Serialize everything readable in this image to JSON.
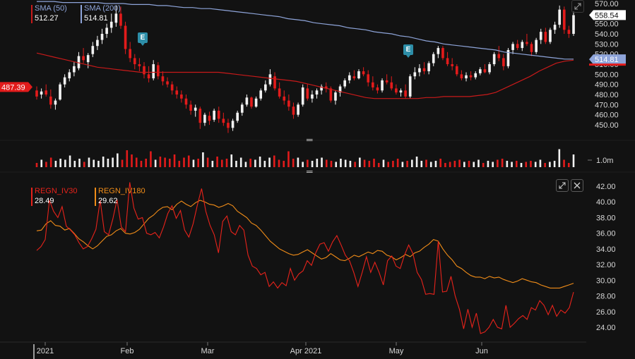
{
  "ticker_legends": {
    "sma50": {
      "label": "SMA (50)",
      "value": "512.27",
      "color": "#c81a1a"
    },
    "sma200": {
      "label": "SMA (200)",
      "value": "514.81",
      "color": "#8ea4d9"
    },
    "iv30": {
      "label": "REGN_IV30",
      "value": "28.49",
      "color": "#e8231b"
    },
    "iv180": {
      "label": "REGN_IV180",
      "value": "29.62",
      "color": "#f08c18"
    }
  },
  "price_flags": {
    "last_price": "558.54",
    "sma200_flag": "514.81",
    "left_flag": "487.39"
  },
  "earnings_markers": [
    "E",
    "E"
  ],
  "volume_label": "1.0m",
  "chart_data": [
    {
      "type": "candlestick",
      "name": "price",
      "y_ticks": [
        450,
        460,
        470,
        480,
        490,
        500,
        510,
        520,
        530,
        540,
        550,
        560,
        570
      ],
      "ylim": [
        441,
        572
      ],
      "x_ticks": [
        "2021",
        "Feb",
        "Mar",
        "Apr 2021",
        "May",
        "Jun"
      ],
      "candles": [
        [
          484,
          488,
          475,
          478
        ],
        [
          480,
          486,
          476,
          483
        ],
        [
          484,
          490,
          478,
          480
        ],
        [
          478,
          485,
          466,
          470
        ],
        [
          470,
          476,
          465,
          474
        ],
        [
          475,
          492,
          474,
          490
        ],
        [
          490,
          500,
          487,
          497
        ],
        [
          496,
          505,
          493,
          502
        ],
        [
          502,
          512,
          498,
          508
        ],
        [
          506,
          522,
          504,
          518
        ],
        [
          518,
          526,
          511,
          514
        ],
        [
          512,
          521,
          506,
          519
        ],
        [
          520,
          532,
          517,
          528
        ],
        [
          528,
          538,
          524,
          534
        ],
        [
          534,
          545,
          530,
          540
        ],
        [
          540,
          550,
          536,
          546
        ],
        [
          546,
          560,
          541,
          552
        ],
        [
          551,
          568,
          547,
          560
        ],
        [
          560,
          567,
          545,
          548
        ],
        [
          548,
          552,
          520,
          525
        ],
        [
          525,
          532,
          512,
          516
        ],
        [
          516,
          520,
          505,
          510
        ],
        [
          510,
          516,
          503,
          508
        ],
        [
          508,
          512,
          496,
          500
        ],
        [
          500,
          508,
          492,
          496
        ],
        [
          496,
          514,
          494,
          510
        ],
        [
          509,
          512,
          495,
          498
        ],
        [
          498,
          503,
          489,
          493
        ],
        [
          493,
          497,
          487,
          490
        ],
        [
          490,
          493,
          480,
          484
        ],
        [
          484,
          488,
          476,
          480
        ],
        [
          480,
          484,
          472,
          476
        ],
        [
          476,
          480,
          466,
          470
        ],
        [
          470,
          474,
          460,
          464
        ],
        [
          464,
          470,
          458,
          467
        ],
        [
          466,
          468,
          446,
          452
        ],
        [
          452,
          462,
          449,
          460
        ],
        [
          459,
          463,
          450,
          454
        ],
        [
          455,
          466,
          453,
          464
        ],
        [
          464,
          468,
          452,
          456
        ],
        [
          456,
          462,
          449,
          452
        ],
        [
          452,
          456,
          442,
          447
        ],
        [
          447,
          456,
          444,
          454
        ],
        [
          454,
          464,
          452,
          462
        ],
        [
          462,
          472,
          459,
          470
        ],
        [
          470,
          480,
          468,
          477
        ],
        [
          477,
          478,
          466,
          468
        ],
        [
          468,
          478,
          467,
          476
        ],
        [
          476,
          486,
          474,
          484
        ],
        [
          484,
          494,
          482,
          490
        ],
        [
          490,
          505,
          488,
          500
        ],
        [
          498,
          502,
          484,
          486
        ],
        [
          486,
          492,
          476,
          478
        ],
        [
          478,
          484,
          470,
          474
        ],
        [
          474,
          480,
          464,
          468
        ],
        [
          468,
          472,
          456,
          460
        ],
        [
          460,
          472,
          458,
          470
        ],
        [
          470,
          490,
          468,
          487
        ],
        [
          486,
          490,
          474,
          476
        ],
        [
          476,
          484,
          472,
          480
        ],
        [
          480,
          486,
          476,
          484
        ],
        [
          484,
          490,
          480,
          488
        ],
        [
          488,
          492,
          482,
          486
        ],
        [
          486,
          488,
          472,
          474
        ],
        [
          474,
          484,
          470,
          482
        ],
        [
          482,
          490,
          478,
          488
        ],
        [
          488,
          496,
          486,
          494
        ],
        [
          494,
          502,
          491,
          499
        ],
        [
          498,
          504,
          494,
          496
        ],
        [
          496,
          505,
          495,
          503
        ],
        [
          503,
          507,
          498,
          500
        ],
        [
          500,
          504,
          488,
          492
        ],
        [
          492,
          498,
          484,
          487
        ],
        [
          487,
          490,
          481,
          484
        ],
        [
          484,
          496,
          482,
          494
        ],
        [
          494,
          500,
          490,
          492
        ],
        [
          492,
          498,
          484,
          486
        ],
        [
          486,
          490,
          480,
          482
        ],
        [
          482,
          486,
          478,
          484
        ],
        [
          484,
          490,
          476,
          478
        ],
        [
          478,
          500,
          476,
          498
        ],
        [
          498,
          507,
          495,
          502
        ],
        [
          502,
          510,
          498,
          506
        ],
        [
          506,
          512,
          500,
          503
        ],
        [
          503,
          513,
          500,
          511
        ],
        [
          511,
          522,
          508,
          520
        ],
        [
          520,
          528,
          516,
          526
        ],
        [
          526,
          528,
          514,
          516
        ],
        [
          516,
          522,
          508,
          510
        ],
        [
          510,
          516,
          504,
          508
        ],
        [
          508,
          510,
          498,
          500
        ],
        [
          500,
          504,
          494,
          496
        ],
        [
          496,
          502,
          493,
          499
        ],
        [
          499,
          503,
          494,
          497
        ],
        [
          497,
          503,
          495,
          501
        ],
        [
          501,
          507,
          499,
          505
        ],
        [
          505,
          510,
          501,
          502
        ],
        [
          502,
          512,
          500,
          510
        ],
        [
          510,
          522,
          508,
          520
        ],
        [
          520,
          528,
          513,
          516
        ],
        [
          516,
          520,
          504,
          508
        ],
        [
          508,
          526,
          506,
          524
        ],
        [
          524,
          532,
          520,
          530
        ],
        [
          530,
          534,
          524,
          526
        ],
        [
          526,
          534,
          523,
          532
        ],
        [
          532,
          540,
          528,
          530
        ],
        [
          530,
          532,
          518,
          522
        ],
        [
          522,
          536,
          520,
          534
        ],
        [
          534,
          545,
          530,
          542
        ],
        [
          542,
          546,
          530,
          532
        ],
        [
          532,
          546,
          530,
          544
        ],
        [
          544,
          552,
          540,
          549
        ],
        [
          549,
          568,
          546,
          564
        ],
        [
          564,
          567,
          540,
          544
        ],
        [
          544,
          548,
          536,
          540
        ],
        [
          540,
          562,
          538,
          558.5
        ]
      ]
    },
    {
      "type": "line",
      "name": "sma_overlays",
      "series": [
        {
          "name": "SMA (50)",
          "values": [
            521,
            519,
            517,
            515,
            513,
            511,
            509,
            507,
            506,
            505,
            504,
            503,
            502,
            502,
            502,
            502,
            502,
            502,
            502,
            502,
            502,
            502,
            501,
            500,
            499,
            498,
            497,
            496,
            495,
            494,
            493,
            491,
            489,
            487,
            485,
            483,
            481,
            479,
            477,
            476,
            476,
            476,
            476,
            476,
            476,
            477,
            477,
            478,
            478,
            478,
            478,
            479,
            480,
            482,
            486,
            490,
            494,
            498,
            503,
            507,
            511,
            513,
            514
          ]
        },
        {
          "name": "SMA (200)",
          "values": [
            572,
            572,
            572,
            571,
            571,
            571,
            571,
            571,
            570,
            570,
            570,
            569,
            569,
            569,
            568,
            568,
            567,
            566,
            566,
            565,
            565,
            564,
            563,
            562,
            561,
            560,
            559,
            558,
            557,
            555,
            554,
            553,
            551,
            550,
            549,
            548,
            546,
            545,
            544,
            542,
            541,
            540,
            538,
            537,
            535,
            533,
            532,
            530,
            529,
            528,
            527,
            526,
            525,
            524,
            522,
            521,
            520,
            519,
            518,
            517,
            516,
            515,
            515
          ]
        }
      ]
    },
    {
      "type": "bar",
      "name": "volume",
      "label": "1.0m",
      "values": [
        0.4,
        0.7,
        0.5,
        0.9,
        0.6,
        0.8,
        0.7,
        1.1,
        0.6,
        0.8,
        0.5,
        0.9,
        0.7,
        0.6,
        1.0,
        0.8,
        0.9,
        1.3,
        0.7,
        1.6,
        1.2,
        0.9,
        0.6,
        0.8,
        1.5,
        0.7,
        1.0,
        0.9,
        0.8,
        1.2,
        0.6,
        0.9,
        1.1,
        0.7,
        0.8,
        1.4,
        0.9,
        0.6,
        1.0,
        0.7,
        0.8,
        1.2,
        0.6,
        0.9,
        0.5,
        0.8,
        0.7,
        1.0,
        0.6,
        0.9,
        1.1,
        0.7,
        0.6,
        1.5,
        0.8,
        0.9,
        0.5,
        0.7,
        0.6,
        0.8,
        0.9,
        0.7,
        0.6,
        0.5,
        0.8,
        0.7,
        0.6,
        0.5,
        0.9,
        0.7,
        0.6,
        0.8,
        0.4,
        0.7,
        0.5,
        0.6,
        0.8,
        0.5,
        0.6,
        0.7,
        1.0,
        0.6,
        0.7,
        0.5,
        0.6,
        0.8,
        0.4,
        0.5,
        0.6,
        0.7,
        0.5,
        0.6,
        0.5,
        0.7,
        0.4,
        0.6,
        0.5,
        0.7,
        0.8,
        0.6,
        0.5,
        0.6,
        0.4,
        0.5,
        0.6,
        0.5,
        0.7,
        0.4,
        0.5,
        0.6,
        1.7,
        0.7,
        0.4,
        1.2
      ],
      "colors_up_down": "derived from candles"
    },
    {
      "type": "line",
      "name": "implied_volatility",
      "y_ticks": [
        24,
        26,
        28,
        30,
        32,
        34,
        36,
        38,
        40,
        42
      ],
      "ylim": [
        22.5,
        43.2
      ],
      "series": [
        {
          "name": "REGN_IV30",
          "values": [
            33.8,
            34.3,
            35.2,
            40.2,
            38.8,
            38.0,
            39.4,
            36.9,
            36.4,
            35.8,
            34.8,
            34.0,
            34.3,
            35.3,
            36.5,
            40.2,
            36.2,
            35.8,
            37.8,
            40.3,
            36.8,
            36.2,
            42.5,
            39.2,
            37.8,
            38.0,
            36.0,
            35.8,
            36.1,
            35.4,
            36.8,
            38.5,
            39.5,
            37.9,
            38.9,
            36.4,
            35.5,
            37.2,
            39.6,
            41.7,
            38.8,
            37.0,
            35.8,
            33.5,
            37.5,
            38.2,
            36.2,
            35.8,
            37.0,
            36.4,
            33.2,
            31.8,
            31.5,
            30.7,
            31.0,
            29.2,
            29.8,
            29.0,
            29.7,
            29.3,
            31.5,
            30.0,
            30.8,
            31.2,
            32.5,
            31.9,
            33.5,
            34.6,
            34.8,
            33.7,
            34.9,
            35.7,
            34.5,
            33.2,
            32.5,
            31.0,
            29.2,
            31.0,
            33.0,
            31.0,
            32.3,
            31.0,
            29.4,
            32.5,
            33.1,
            31.8,
            31.5,
            33.2,
            34.5,
            33.4,
            31.0,
            30.1,
            28.2,
            28.3,
            28.2,
            35.0,
            28.5,
            28.6,
            30.5,
            28.0,
            26.3,
            23.8,
            26.3,
            24.0,
            25.8,
            23.2,
            23.4,
            24.0,
            25.0,
            24.0,
            23.8,
            26.8,
            24.0,
            24.5,
            25.1,
            25.5,
            25.0,
            26.5,
            26.2,
            27.4,
            26.8,
            25.6,
            26.8,
            25.4,
            26.2,
            25.8,
            26.5,
            28.49
          ]
        },
        {
          "name": "REGN_IV180",
          "values": [
            36.3,
            36.4,
            37.2,
            37.6,
            37.0,
            36.9,
            36.4,
            36.6,
            36.0,
            35.3,
            34.9,
            34.4,
            34.0,
            34.4,
            35.0,
            35.6,
            35.8,
            36.3,
            36.6,
            36.0,
            35.9,
            36.1,
            36.5,
            37.2,
            37.9,
            38.3,
            38.9,
            39.3,
            39.4,
            39.0,
            39.7,
            40.1,
            39.7,
            39.4,
            39.9,
            40.2,
            40.0,
            39.7,
            39.6,
            39.3,
            39.5,
            39.8,
            39.5,
            38.8,
            38.4,
            38.0,
            37.3,
            37.0,
            36.4,
            35.7,
            35.0,
            34.5,
            34.0,
            33.7,
            33.4,
            33.2,
            33.3,
            33.6,
            33.9,
            33.5,
            33.1,
            32.7,
            32.9,
            33.4,
            33.0,
            32.6,
            32.5,
            32.8,
            33.2,
            33.0,
            33.3,
            33.6,
            33.4,
            33.8,
            33.7,
            33.2,
            33.0,
            32.6,
            32.9,
            33.3,
            33.0,
            33.5,
            33.7,
            34.2,
            34.6,
            35.2,
            35.0,
            34.0,
            33.2,
            32.6,
            31.8,
            31.5,
            31.0,
            30.6,
            30.4,
            30.4,
            30.2,
            30.5,
            30.3,
            30.4,
            30.1,
            29.9,
            29.7,
            29.9,
            30.2,
            30.0,
            29.8,
            29.7,
            29.4,
            29.2,
            29.0,
            29.0,
            29.0,
            29.2,
            29.4,
            29.62
          ]
        }
      ]
    }
  ]
}
